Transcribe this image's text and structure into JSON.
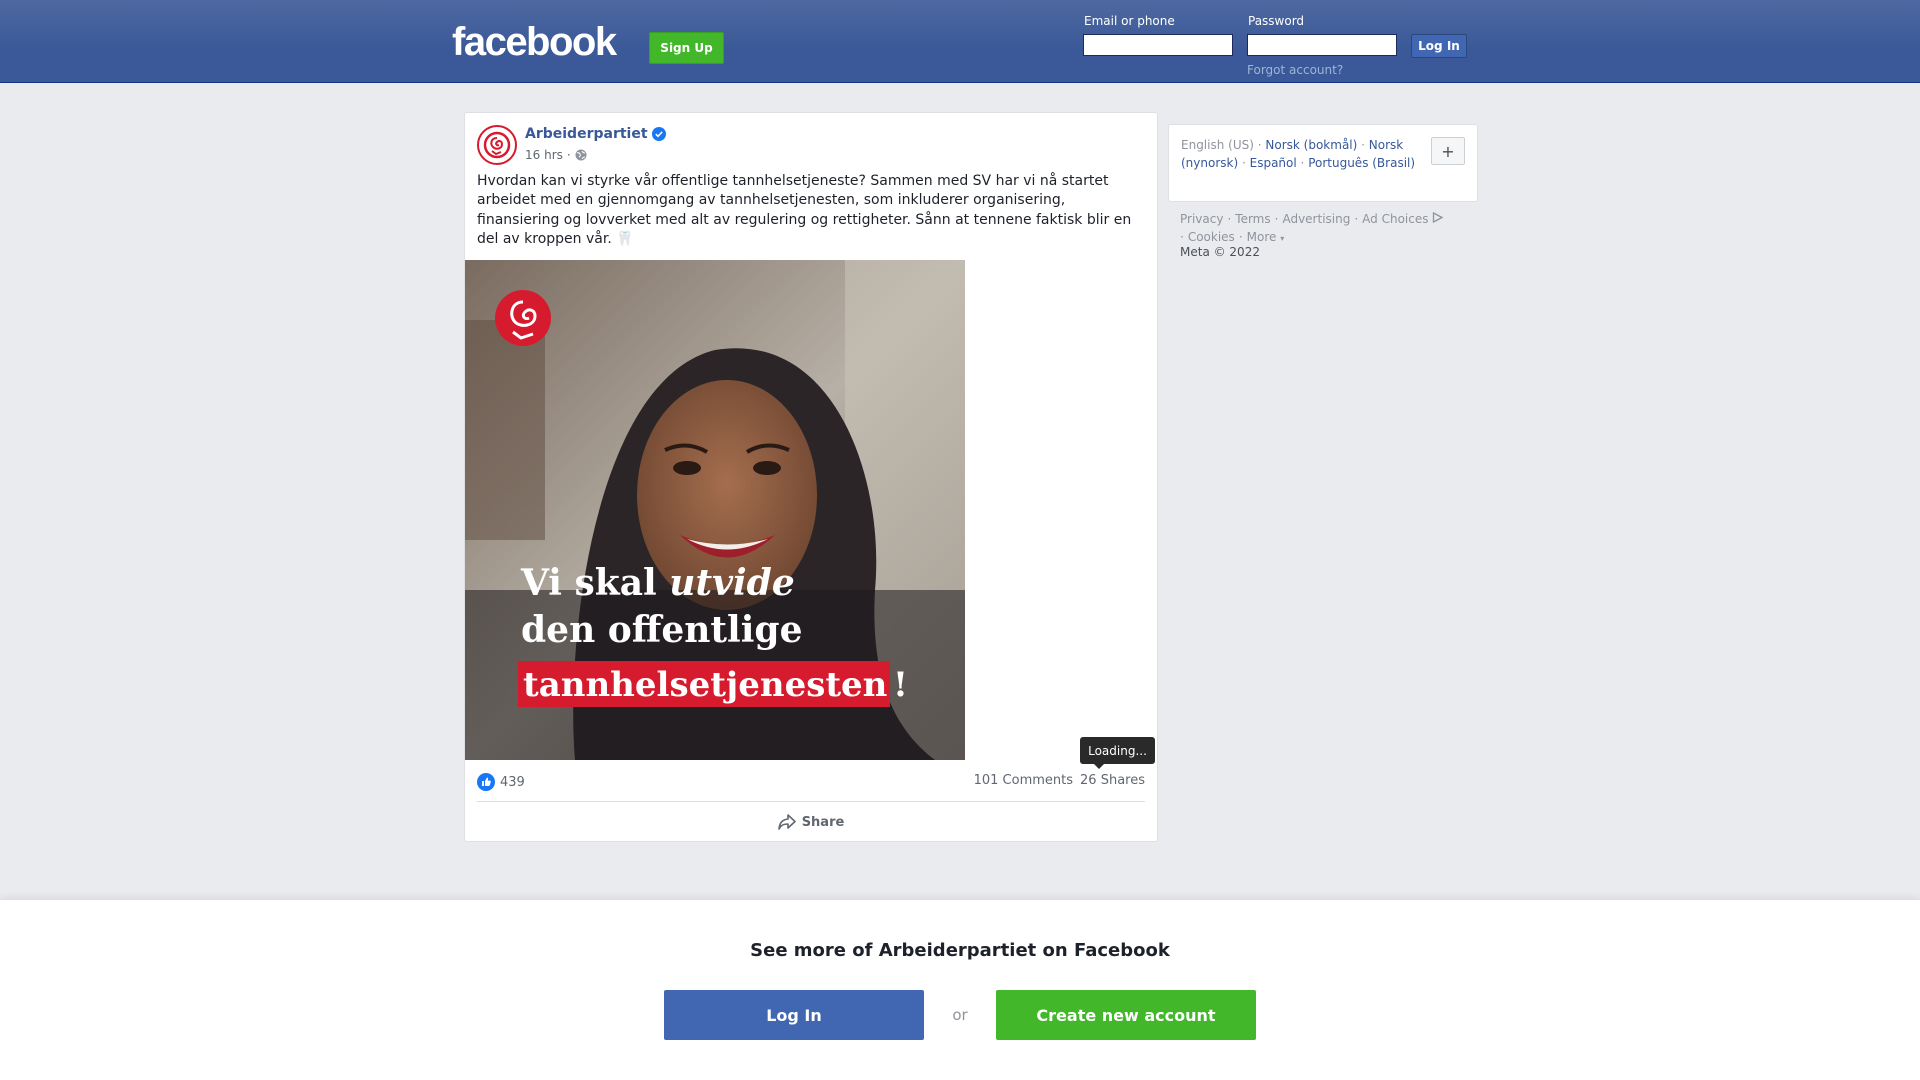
{
  "colors": {
    "brand_blue": "#3b5998",
    "button_blue": "#4267b2",
    "green": "#42b72a",
    "link": "#385898",
    "ap_red": "#d71b2f"
  },
  "header": {
    "logo": "facebook",
    "signup_label": "Sign Up",
    "email_label": "Email or phone",
    "email_value": "",
    "password_label": "Password",
    "password_value": "",
    "login_label": "Log In",
    "forgot_label": "Forgot account?"
  },
  "post": {
    "page_name": "Arbeiderpartiet",
    "verified": true,
    "time": "16 hrs",
    "audience_icon": "globe-icon",
    "text": "Hvordan kan vi styrke vår offentlige tannhelsetjeneste? Sammen med SV har vi nå startet arbeidet med en gjennomgang av tannhelsetjenesten, som inkluderer organisering, finansiering og lovverket med alt av regulering og rettigheter. Sånn at tennene faktisk blir en del av kroppen vår. 🦷",
    "image": {
      "headline_line1_a": "Vi skal ",
      "headline_line1_b": "utvide",
      "headline_line2": "den offentlige",
      "headline_line3": "tannhelsetjenesten",
      "headline_line3_suffix": "!"
    },
    "like_count": "439",
    "comments": "101 Comments",
    "shares": "26 Shares",
    "tooltip": "Loading...",
    "share_label": "Share"
  },
  "sidebar": {
    "languages": [
      {
        "label": "English (US)",
        "current": true
      },
      {
        "label": "Norsk (bokmål)",
        "current": false
      },
      {
        "label": "Norsk (nynorsk)",
        "current": false
      },
      {
        "label": "Español",
        "current": false
      },
      {
        "label": "Português (Brasil)",
        "current": false
      }
    ],
    "add_language": "+",
    "footer_links": [
      "Privacy",
      "Terms",
      "Advertising",
      "Ad Choices",
      "Cookies",
      "More"
    ],
    "copyright": "Meta © 2022"
  },
  "banner": {
    "title": "See more of Arbeiderpartiet on Facebook",
    "login_label": "Log In",
    "or_label": "or",
    "create_label": "Create new account"
  }
}
